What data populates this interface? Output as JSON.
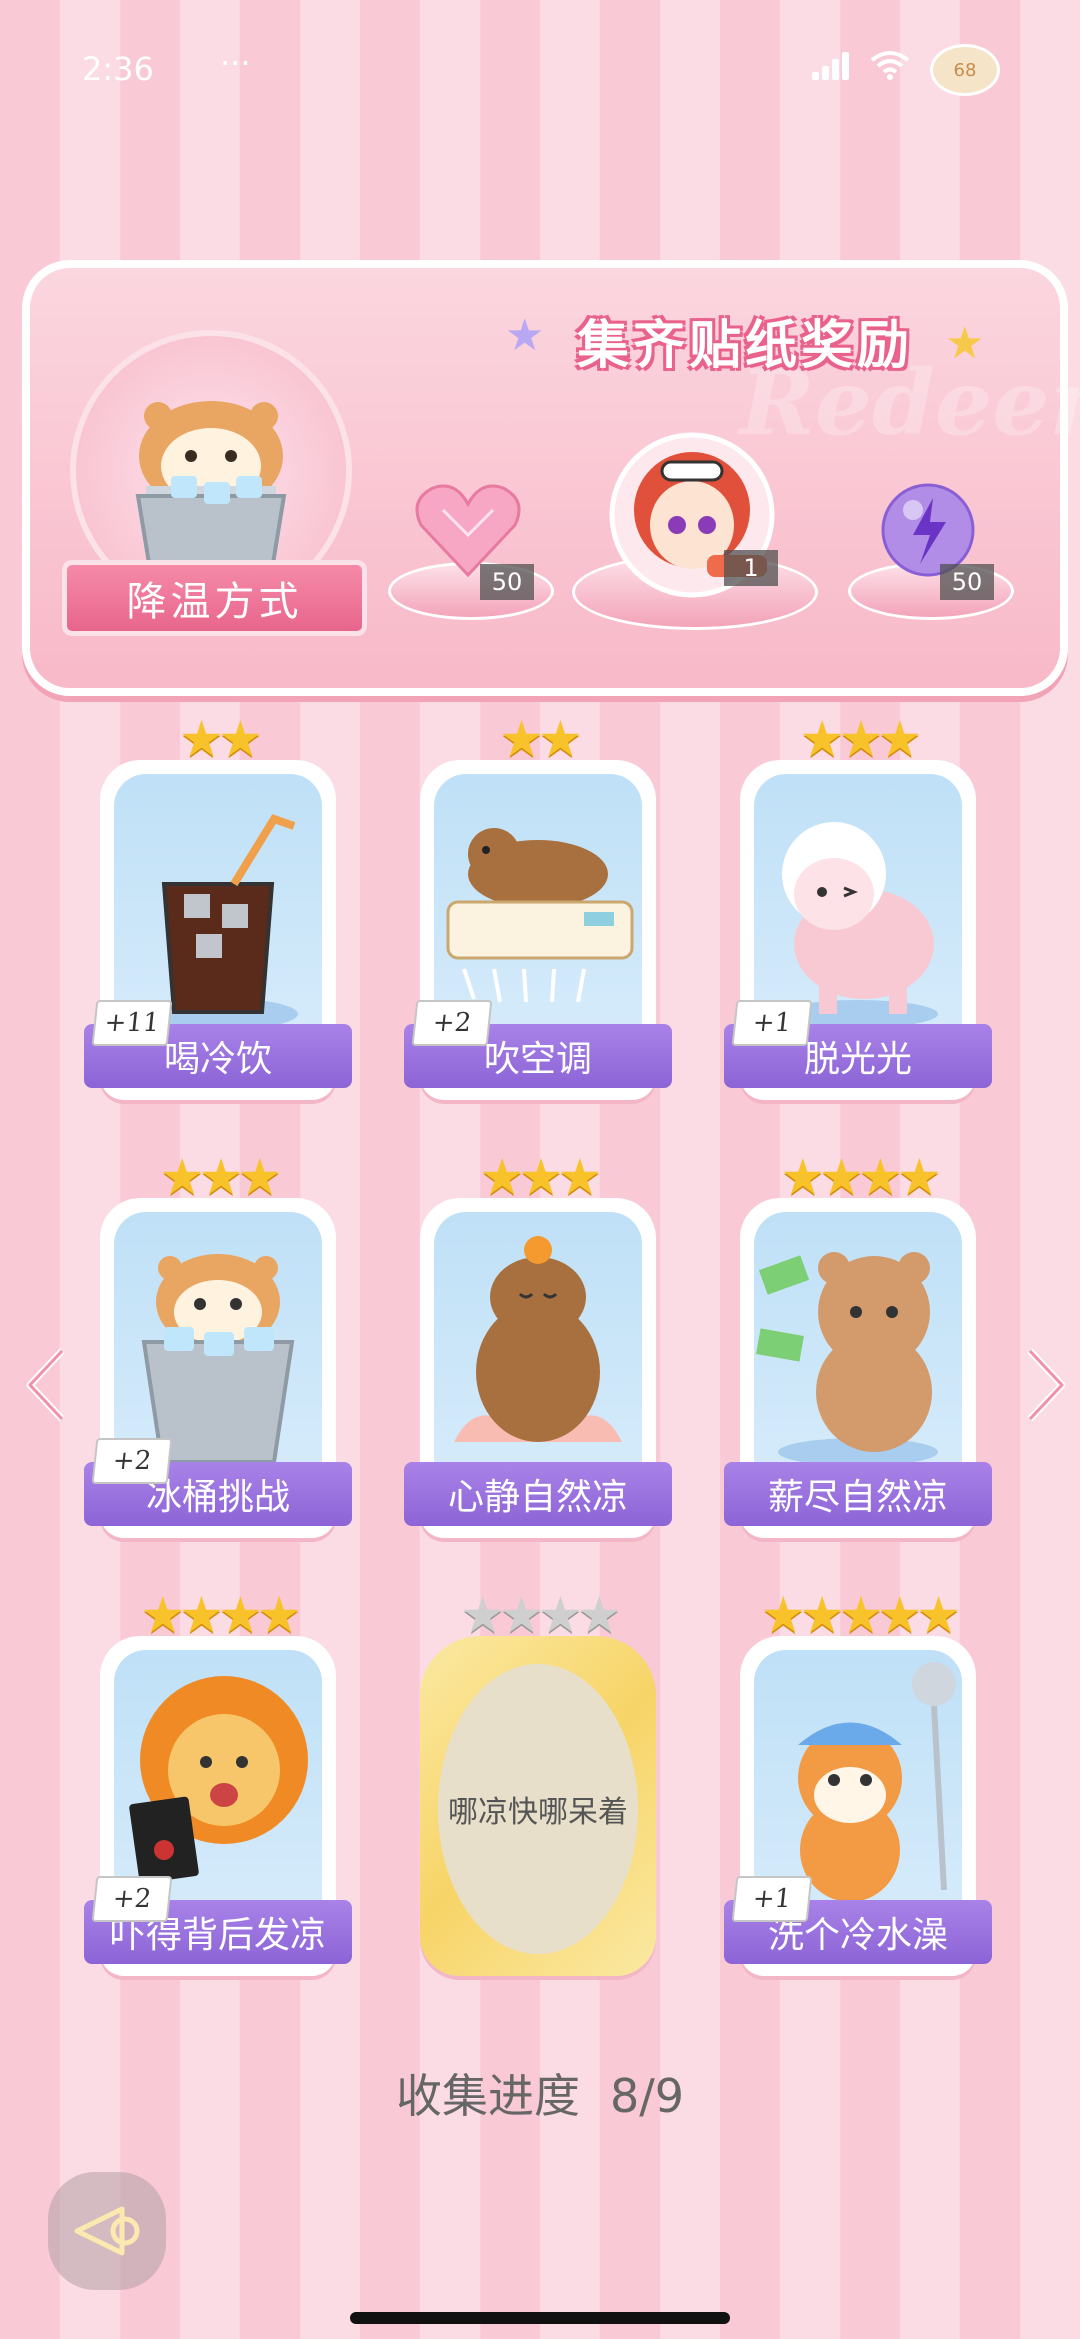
{
  "status_bar": {
    "time": "2:36",
    "dots": "···",
    "battery": "68"
  },
  "banner": {
    "title": "集齐贴纸奖励",
    "watermark": "Redeem",
    "method_label": "降温方式",
    "rewards": [
      {
        "name": "heart-gem",
        "count": "50"
      },
      {
        "name": "character-avatar",
        "count": "1"
      },
      {
        "name": "lightning-orb",
        "count": "50"
      }
    ]
  },
  "cards": [
    {
      "label": "喝冷饮",
      "plus": "+11",
      "stars": 2,
      "locked": false,
      "icon": "iced-drink-icon"
    },
    {
      "label": "吹空调",
      "plus": "+2",
      "stars": 2,
      "locked": false,
      "icon": "capybara-aircon-icon"
    },
    {
      "label": "脱光光",
      "plus": "+1",
      "stars": 3,
      "locked": false,
      "icon": "sheep-icon"
    },
    {
      "label": "冰桶挑战",
      "plus": "+2",
      "stars": 3,
      "locked": false,
      "icon": "hamster-ice-bucket-icon"
    },
    {
      "label": "心静自然凉",
      "plus": "",
      "stars": 3,
      "locked": false,
      "icon": "capybara-meditate-icon"
    },
    {
      "label": "薪尽自然凉",
      "plus": "",
      "stars": 4,
      "locked": false,
      "icon": "bear-money-icon"
    },
    {
      "label": "吓得背后发凉",
      "plus": "+2",
      "stars": 4,
      "locked": false,
      "icon": "lion-horror-icon"
    },
    {
      "label": "哪凉快哪呆着",
      "plus": "",
      "stars": 4,
      "locked": true,
      "icon": ""
    },
    {
      "label": "洗个冷水澡",
      "plus": "+1",
      "stars": 5,
      "locked": false,
      "icon": "cat-shower-icon"
    }
  ],
  "progress": {
    "label": "收集进度",
    "value": "8/9"
  },
  "colors": {
    "ribbon": "#9a70dd",
    "star_gold": "#f8c32a",
    "banner_pink": "#f8b9c8"
  }
}
